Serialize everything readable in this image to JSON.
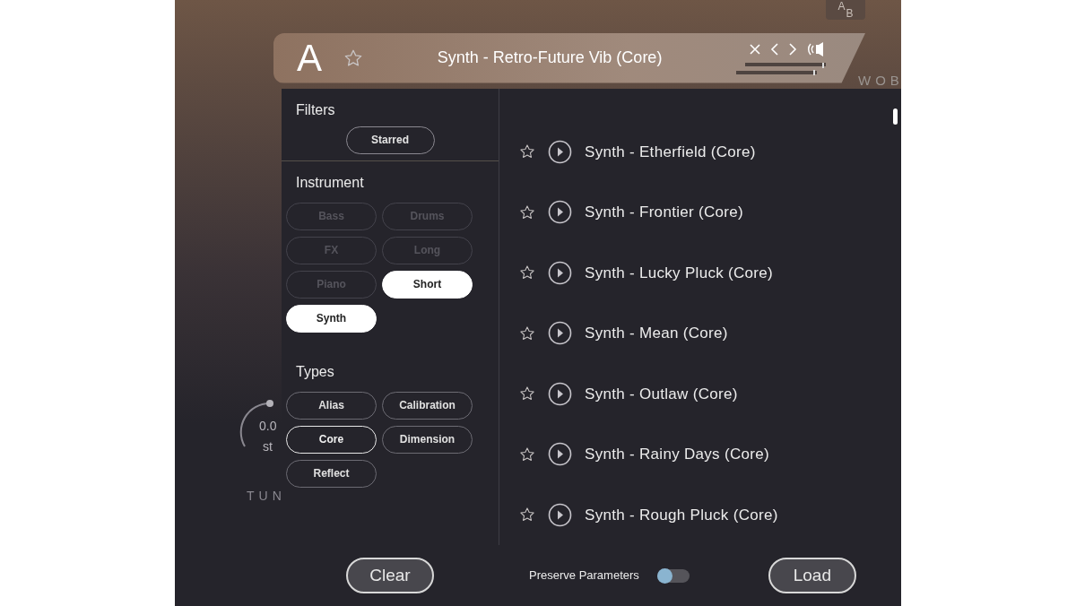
{
  "background": {
    "ab_label": "A",
    "ab_sub": "B",
    "side_label": "WOB",
    "knob_value": "0.0",
    "knob_unit": "st",
    "knob_label": "TUN"
  },
  "header": {
    "slot": "A",
    "starred": false,
    "title": "Synth - Retro-Future Vib (Core)"
  },
  "filters": {
    "title": "Filters",
    "chips": [
      {
        "label": "Starred",
        "selected": false
      }
    ]
  },
  "instrument": {
    "title": "Instrument",
    "chips": [
      {
        "label": "Bass",
        "selected": false,
        "disabled": true
      },
      {
        "label": "Drums",
        "selected": false,
        "disabled": true
      },
      {
        "label": "FX",
        "selected": false,
        "disabled": true
      },
      {
        "label": "Long",
        "selected": false,
        "disabled": true
      },
      {
        "label": "Piano",
        "selected": false,
        "disabled": true
      },
      {
        "label": "Short",
        "selected": true,
        "disabled": false
      },
      {
        "label": "Synth",
        "selected": true,
        "disabled": false
      }
    ]
  },
  "types": {
    "title": "Types",
    "chips": [
      {
        "label": "Alias",
        "selected": false
      },
      {
        "label": "Calibration",
        "selected": false
      },
      {
        "label": "Core",
        "selected": true
      },
      {
        "label": "Dimension",
        "selected": false
      },
      {
        "label": "Reflect",
        "selected": false
      }
    ]
  },
  "presets": [
    {
      "name": "Synth - Etherfield (Core)",
      "starred": false
    },
    {
      "name": "Synth - Frontier (Core)",
      "starred": false
    },
    {
      "name": "Synth - Lucky Pluck (Core)",
      "starred": false
    },
    {
      "name": "Synth - Mean (Core)",
      "starred": false
    },
    {
      "name": "Synth - Outlaw (Core)",
      "starred": false
    },
    {
      "name": "Synth - Rainy Days (Core)",
      "starred": false
    },
    {
      "name": "Synth - Rough Pluck (Core)",
      "starred": false
    }
  ],
  "footer": {
    "clear": "Clear",
    "preserve_label": "Preserve Parameters",
    "preserve_on": false,
    "load": "Load"
  }
}
